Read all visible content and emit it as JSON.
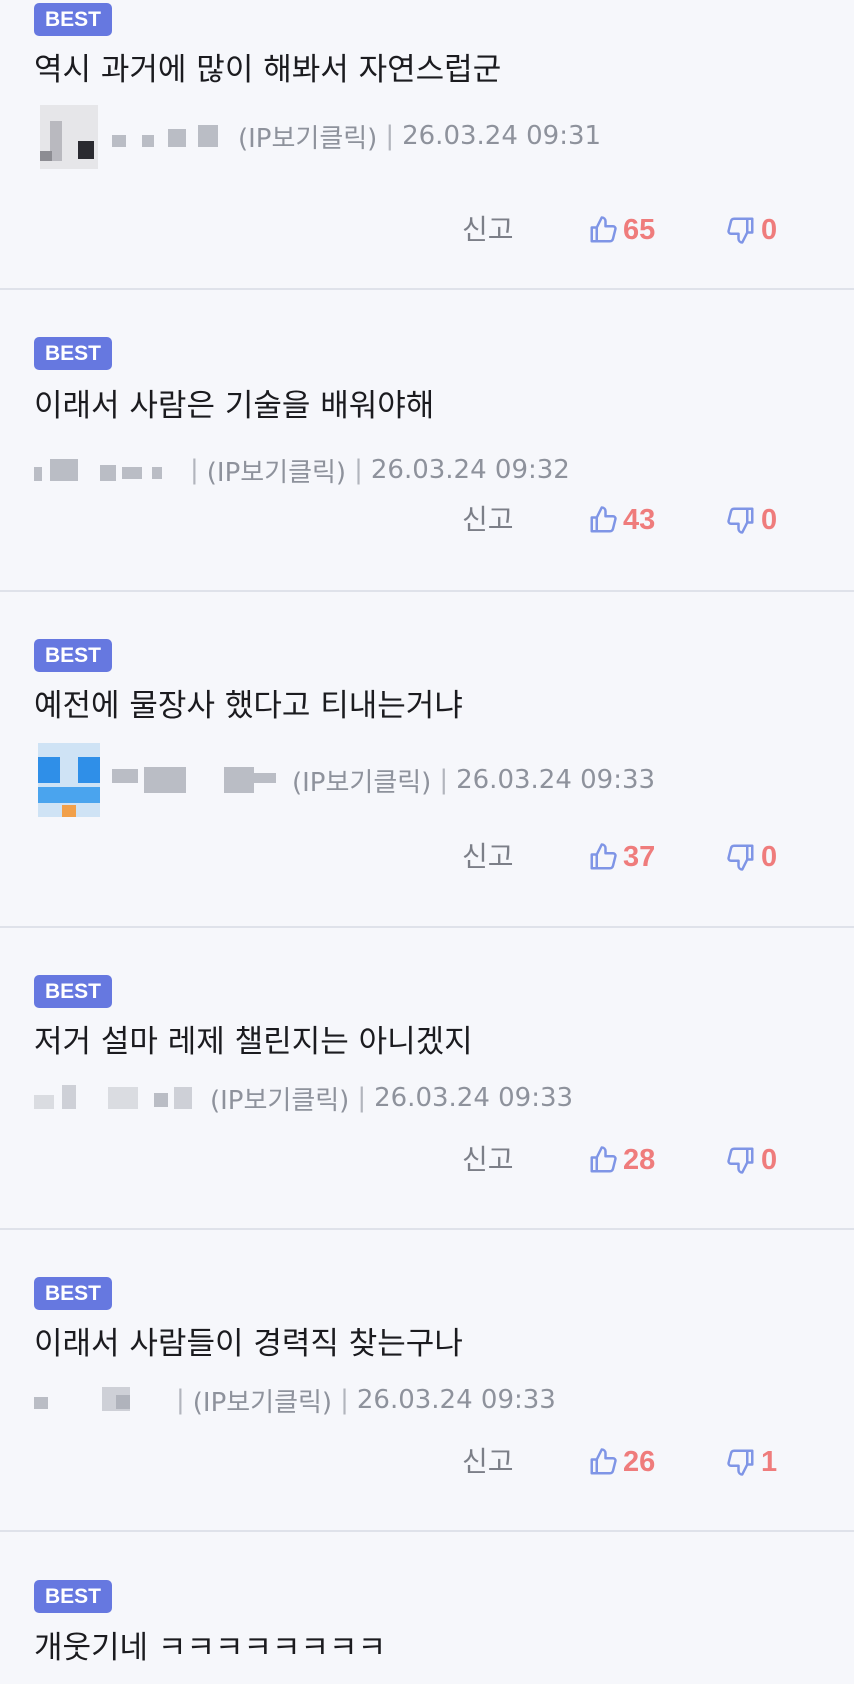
{
  "colors": {
    "badge": "#6678e0",
    "count": "#ef7c7c",
    "thumb_icon": "#7f95e6",
    "text": "#1b1b1f",
    "meta": "#8e929c",
    "divider": "#dfe2ea",
    "background": "#f6f7fb"
  },
  "comments": [
    {
      "badge": "BEST",
      "text": "역시 과거에 많이 해봐서 자연스럽군",
      "ip_label": "(IP보기클릭)",
      "separator": "|",
      "date": "26.03.24 09:31",
      "report_label": "신고",
      "like_icon": "thumbs-up-icon",
      "likes": "65",
      "dislike_icon": "thumbs-down-icon",
      "dislikes": "0"
    },
    {
      "badge": "BEST",
      "text": "이래서 사람은 기술을 배워야해",
      "ip_label": "(IP보기클릭)",
      "separator": "|",
      "date": "26.03.24 09:32",
      "report_label": "신고",
      "like_icon": "thumbs-up-icon",
      "likes": "43",
      "dislike_icon": "thumbs-down-icon",
      "dislikes": "0"
    },
    {
      "badge": "BEST",
      "text": "예전에 물장사 했다고 티내는거냐",
      "ip_label": "(IP보기클릭)",
      "separator": "|",
      "date": "26.03.24 09:33",
      "report_label": "신고",
      "like_icon": "thumbs-up-icon",
      "likes": "37",
      "dislike_icon": "thumbs-down-icon",
      "dislikes": "0"
    },
    {
      "badge": "BEST",
      "text": "저거 설마 레제 챌린지는 아니겠지",
      "ip_label": "(IP보기클릭)",
      "separator": "|",
      "date": "26.03.24 09:33",
      "report_label": "신고",
      "like_icon": "thumbs-up-icon",
      "likes": "28",
      "dislike_icon": "thumbs-down-icon",
      "dislikes": "0"
    },
    {
      "badge": "BEST",
      "text": "이래서 사람들이 경력직 찾는구나",
      "ip_label": "(IP보기클릭)",
      "separator": "|",
      "date": "26.03.24 09:33",
      "report_label": "신고",
      "like_icon": "thumbs-up-icon",
      "likes": "26",
      "dislike_icon": "thumbs-down-icon",
      "dislikes": "1"
    },
    {
      "badge": "BEST",
      "text": "개웃기네 ㅋㅋㅋㅋㅋㅋㅋㅋ"
    }
  ]
}
